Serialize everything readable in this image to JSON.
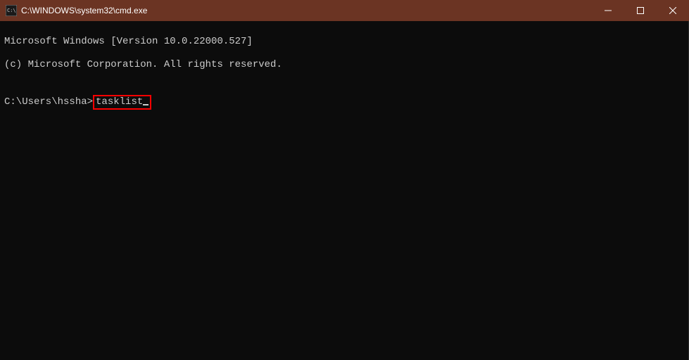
{
  "titlebar": {
    "title": "C:\\WINDOWS\\system32\\cmd.exe"
  },
  "terminal": {
    "line1": "Microsoft Windows [Version 10.0.22000.527]",
    "line2": "(c) Microsoft Corporation. All rights reserved.",
    "blank": "",
    "prompt": "C:\\Users\\hssha>",
    "command": "tasklist"
  },
  "colors": {
    "titlebar_bg": "#6b3423",
    "terminal_bg": "#0c0c0c",
    "terminal_fg": "#cccccc",
    "highlight": "#ff0000"
  }
}
